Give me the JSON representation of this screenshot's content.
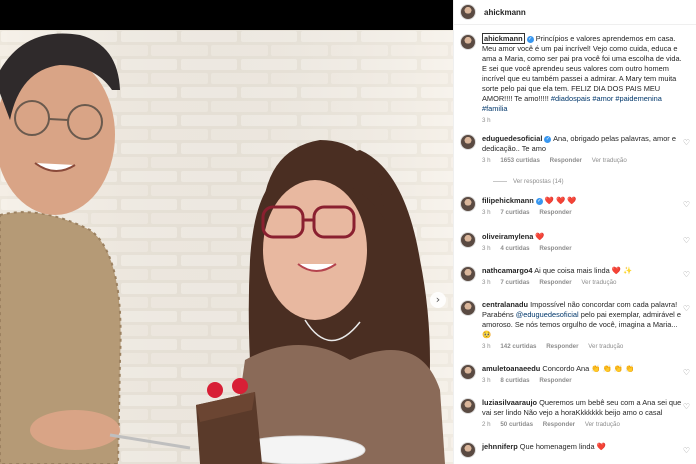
{
  "post": {
    "author": "ahickmann",
    "caption_author": "ahickmann",
    "caption_text": "Princípios e valores aprendemos em casa. Meu amor você é um pai incrível! Vejo como cuida, educa e ama a Maria, como ser pai pra você foi uma escolha de vida. E sei que você aprendeu seus valores com outro homem incrível que eu também passei a admirar. A Mary tem muita sorte pelo pai que ela tem. FELIZ DIA DOS PAIS MEU AMOR!!!! Te amo!!!!!",
    "hashtags": "#diadospais #amor #paidemenina #familia",
    "time": "3 h"
  },
  "comments": [
    {
      "user": "eduguedesoficial",
      "verified": true,
      "text": "Ana, obrigado pelas palavras, amor e dedicação.. Te amo",
      "time": "3 h",
      "likes": "1653 curtidas",
      "reply": "Responder",
      "translate": "Ver tradução",
      "replies": "Ver respostas (14)"
    },
    {
      "user": "filipehickmann",
      "verified": true,
      "text": "❤️ ❤️ ❤️",
      "time": "3 h",
      "likes": "7 curtidas",
      "reply": "Responder"
    },
    {
      "user": "oliveiramylena",
      "text": "❤️",
      "time": "3 h",
      "likes": "4 curtidas",
      "reply": "Responder"
    },
    {
      "user": "nathcamargo4",
      "text": "Ai que coisa mais linda ❤️ ✨",
      "time": "3 h",
      "likes": "7 curtidas",
      "reply": "Responder",
      "translate": "Ver tradução"
    },
    {
      "user": "centralanadu",
      "text_before": "Impossível não concordar com cada palavra! Parabéns ",
      "mention": "@eduguedesoficial",
      "text_after": " pelo pai exemplar, admirável e amoroso. Se nós temos orgulho de você, imagina a Maria... 🥺",
      "time": "3 h",
      "likes": "142 curtidas",
      "reply": "Responder",
      "translate": "Ver tradução"
    },
    {
      "user": "amuletoanaeedu",
      "text": "Concordo Ana 👏 👏 👏 👏",
      "time": "3 h",
      "likes": "8 curtidas",
      "reply": "Responder"
    },
    {
      "user": "luziasilvaaraujo",
      "text": "Queremos um bebê seu com a Ana sei que vai ser lindo Não vejo a horaKkkkkkk beijo amo o casal",
      "time": "2 h",
      "likes": "50 curtidas",
      "reply": "Responder",
      "translate": "Ver tradução"
    },
    {
      "user": "jehnniferp",
      "text": "Que homenagem linda ❤️"
    }
  ],
  "icons": {
    "verified": "verified-badge-icon",
    "like": "heart-outline-icon",
    "next": "chevron-right-icon"
  },
  "colors": {
    "link": "#00376b",
    "muted": "#8e8e8e",
    "verified": "#3897f0",
    "heart": "#ed4956"
  }
}
